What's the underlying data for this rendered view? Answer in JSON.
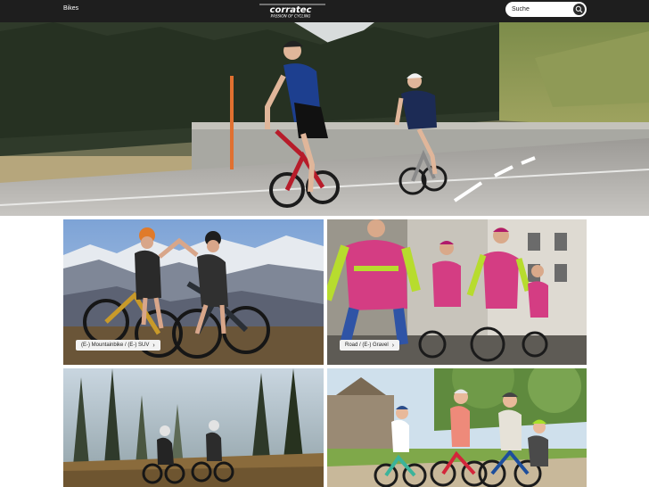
{
  "header": {
    "nav_bikes": "Bikes",
    "logo_text": "corratec",
    "logo_tagline": "PASSION OF CYCLING",
    "search_placeholder": "Suche",
    "search_icon": "search-icon"
  },
  "categories": [
    {
      "label": "(E-) Mountainbike / (E-) SUV",
      "chevron": "›"
    },
    {
      "label": "Road / (E-) Gravel",
      "chevron": "›"
    }
  ],
  "colors": {
    "topbar": "#1e1e1e",
    "label_bg": "#f2f2f2",
    "page_bg": "#ffffff"
  }
}
